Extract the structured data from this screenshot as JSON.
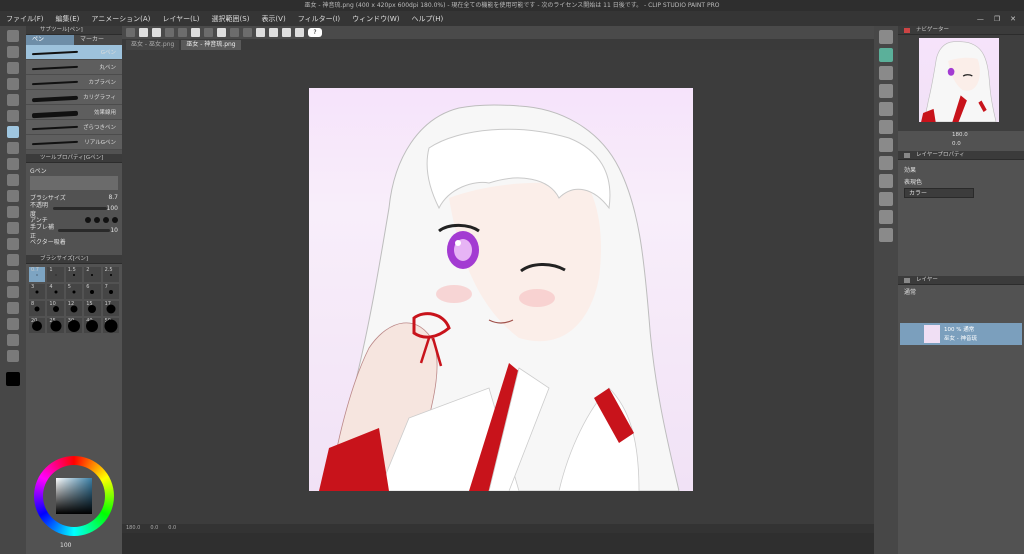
{
  "window": {
    "title": "巫女 - 神音琉.png (400 x 420px 600dpi 180.0%) - 現在全ての機能を使用可能です - 次のライセンス開始は 11 日後です。 - CLIP STUDIO PAINT PRO",
    "controls": [
      "—",
      "❐",
      "✕"
    ]
  },
  "menu": [
    "ファイル(F)",
    "編集(E)",
    "アニメーション(A)",
    "レイヤー(L)",
    "選択範囲(S)",
    "表示(V)",
    "フィルター(I)",
    "ウィンドウ(W)",
    "ヘルプ(H)"
  ],
  "toolbar": {
    "help_label": "?"
  },
  "tabs": [
    "巫女 - 巫女.png",
    "巫女 - 神音琉.png"
  ],
  "left_panel": {
    "subtool_header": "サブツール[ペン]",
    "subtabs": [
      "ペン",
      "マーカー"
    ],
    "brushes": [
      {
        "label": "Gペン",
        "selected": true
      },
      {
        "label": "丸ペン",
        "selected": false
      },
      {
        "label": "カブラペン",
        "selected": false
      },
      {
        "label": "カリグラフィ",
        "selected": false
      },
      {
        "label": "効果線用",
        "selected": false
      },
      {
        "label": "ざらつきペン",
        "selected": false
      },
      {
        "label": "リアルGペン",
        "selected": false
      }
    ],
    "tool_property_header": "ツールプロパティ[Gペン]",
    "tool_property_name": "Gペン",
    "props": [
      {
        "label": "ブラシサイズ",
        "value": "8.7"
      },
      {
        "label": "不透明度",
        "value": "100"
      },
      {
        "label": "アンチ",
        "value": ""
      },
      {
        "label": "手ブレ補正",
        "value": "10"
      },
      {
        "label": "ベクター吸着",
        "value": ""
      }
    ],
    "brush_size_header": "ブラシサイズ[ペン]",
    "sizes": [
      "0.7",
      "1",
      "1.5",
      "2",
      "2.5",
      "3",
      "4",
      "5",
      "6",
      "7",
      "8",
      "10",
      "12",
      "15",
      "17",
      "20",
      "25",
      "30",
      "40",
      "50",
      "60",
      "70",
      "80",
      "100",
      "120"
    ],
    "color_value": "100"
  },
  "status": {
    "zoom": "180.0",
    "angle": "0.0",
    "flip": "0.0"
  },
  "right_panel": {
    "navigator_header": "ナビゲーター",
    "nav_zoom": "180.0",
    "nav_angle": "0.0",
    "layer_property_header": "レイヤープロパティ",
    "effect_label": "効果",
    "expression_color_label": "表現色",
    "expression_color_value": "カラー",
    "layer_header": "レイヤー",
    "blend_mode": "通常",
    "layer_opacity_line": "100 % 通常",
    "layer_name": "巫女 - 神音琉"
  },
  "colors": {
    "accent": "#7b9fbd",
    "selected_tool": "#9fc6e0",
    "hakama_red": "#c8131b",
    "eye_purple": "#a33bd2",
    "canvas_bg": "#f6e3fb"
  }
}
